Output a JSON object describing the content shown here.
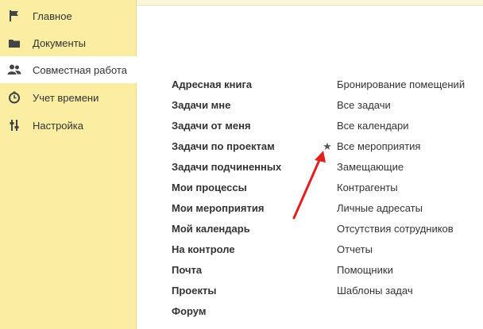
{
  "sidebar": {
    "items": [
      {
        "label": "Главное",
        "icon": "flag-icon"
      },
      {
        "label": "Документы",
        "icon": "folder-icon"
      },
      {
        "label": "Совместная работа",
        "icon": "users-icon"
      },
      {
        "label": "Учет времени",
        "icon": "clock-icon"
      },
      {
        "label": "Настройка",
        "icon": "settings-sliders-icon"
      }
    ],
    "active_index": 2,
    "background": "#fbeda1"
  },
  "main": {
    "left_links": [
      "Адресная книга",
      "Задачи мне",
      "Задачи от меня",
      "Задачи по проектам",
      "Задачи подчиненных",
      "Мои процессы",
      "Мои мероприятия",
      "Мой календарь",
      "На контроле",
      "Почта",
      "Проекты",
      "Форум"
    ],
    "right_links": [
      "Бронирование помещений",
      "Все задачи",
      "Все календари",
      "Все мероприятия",
      "Замещающие",
      "Контрагенты",
      "Личные адресаты",
      "Отсутствия сотрудников",
      "Отчеты",
      "Помощники",
      "Шаблоны задач"
    ],
    "starred_item": "Все мероприятия",
    "star_icon": "star-icon",
    "annotation_arrow_color": "#e02020"
  }
}
